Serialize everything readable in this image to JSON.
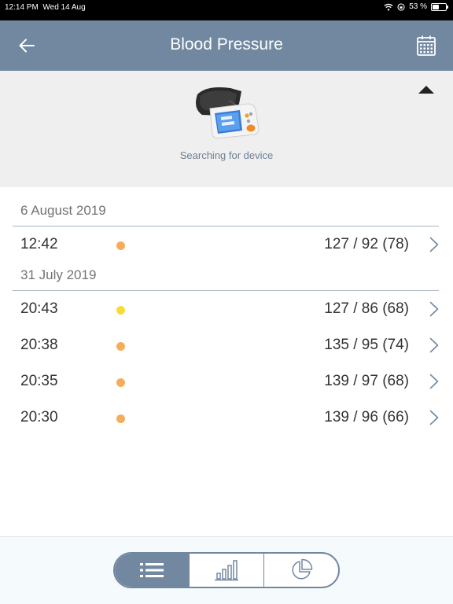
{
  "status_bar": {
    "time": "12:14 PM",
    "date": "Wed 14 Aug",
    "battery_text": "53 %",
    "battery_level": 0.53
  },
  "nav": {
    "title": "Blood Pressure",
    "back_icon": "arrow-left-icon",
    "calendar_icon": "calendar-icon"
  },
  "device": {
    "status": "Searching for device",
    "collapse_icon": "triangle-up-icon",
    "image": "blood-pressure-monitor"
  },
  "groups": [
    {
      "date": "6 August 2019",
      "readings": [
        {
          "time": "12:42",
          "value": "127 / 92 (78)",
          "status_color": "#f5ad5b"
        }
      ]
    },
    {
      "date": "31 July 2019",
      "readings": [
        {
          "time": "20:43",
          "value": "127 / 86 (68)",
          "status_color": "#f5dc3c"
        },
        {
          "time": "20:38",
          "value": "135 / 95 (74)",
          "status_color": "#f5ad5b"
        },
        {
          "time": "20:35",
          "value": "139 / 97 (68)",
          "status_color": "#f5ad5b"
        },
        {
          "time": "20:30",
          "value": "139 / 96 (66)",
          "status_color": "#f5ad5b"
        }
      ]
    }
  ],
  "tabs": [
    {
      "icon": "list-icon",
      "active": true
    },
    {
      "icon": "bar-chart-icon",
      "active": false
    },
    {
      "icon": "pie-chart-icon",
      "active": false
    }
  ],
  "colors": {
    "accent": "#7288a1",
    "panel_bg": "#efefef",
    "divider": "#a9b4c2"
  }
}
